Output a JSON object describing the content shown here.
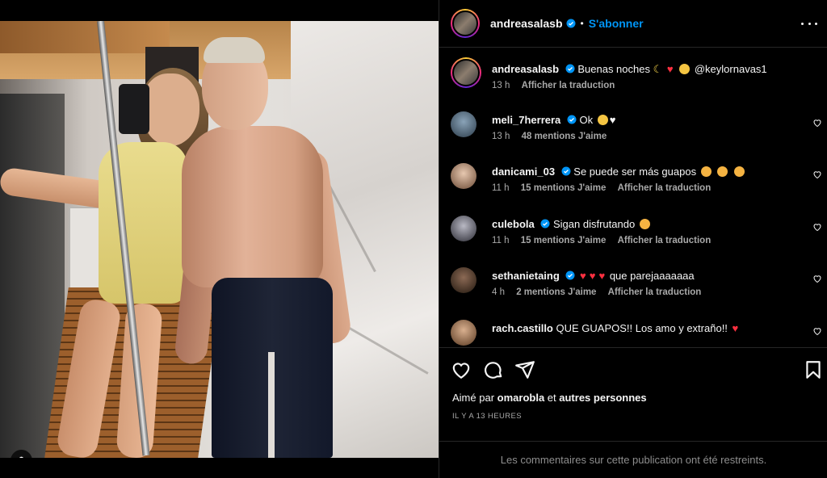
{
  "post": {
    "username": "andreasalasb",
    "separator": "•",
    "follow_label": "S'abonner",
    "caption": {
      "username": "andreasalasb",
      "text": "Buenas noches",
      "mention": "@keylornavas1",
      "time": "13 h",
      "translate": "Afficher la traduction"
    }
  },
  "comments": [
    {
      "username": "meli_7herrera",
      "verified": true,
      "text": "Ok",
      "time": "13 h",
      "likes": "48 mentions J'aime",
      "translate": ""
    },
    {
      "username": "danicami_03",
      "verified": true,
      "text": "Se puede ser más guapos",
      "time": "11 h",
      "likes": "15 mentions J'aime",
      "translate": "Afficher la traduction"
    },
    {
      "username": "culebola",
      "verified": true,
      "text": "Sigan disfrutando",
      "time": "11 h",
      "likes": "15 mentions J'aime",
      "translate": "Afficher la traduction"
    },
    {
      "username": "sethanietaing",
      "verified": true,
      "text": "que parejaaaaaaa",
      "time": "4 h",
      "likes": "2 mentions J'aime",
      "translate": "Afficher la traduction"
    },
    {
      "username": "rach.castillo",
      "verified": false,
      "text": "QUE GUAPOS!! Los amo y extraño!!",
      "time": "",
      "likes": "",
      "translate": ""
    }
  ],
  "likes": {
    "prefix": "Aimé par",
    "user": "omarobla",
    "connector": "et",
    "others": "autres personnes"
  },
  "timestamp": "IL Y A 13 HEURES",
  "restricted_notice": "Les commentaires sur cette publication ont été restreints.",
  "colors": {
    "accent": "#0095f6",
    "verified": "#0095f6",
    "heart": "#ff3040",
    "muted": "#a8a8a8"
  },
  "icons": [
    "like-icon",
    "comment-icon",
    "share-icon",
    "save-icon",
    "more-icon",
    "verified-icon",
    "user-tag-icon"
  ]
}
